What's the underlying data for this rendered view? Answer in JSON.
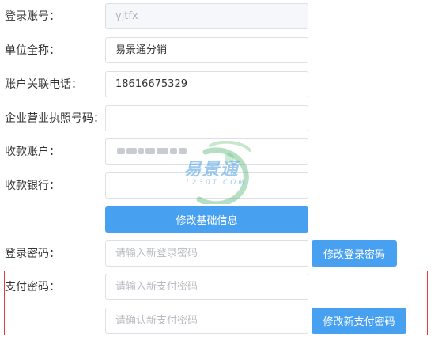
{
  "form": {
    "login_account": {
      "label": "登录账号：",
      "value": "yjtfx"
    },
    "company_name": {
      "label": "单位全称：",
      "value": "易景通分销"
    },
    "phone": {
      "label": "账户关联电话：",
      "value": "18616675329"
    },
    "license": {
      "label": "企业营业执照号码：",
      "value": ""
    },
    "receive_account": {
      "label": "收款账户："
    },
    "receive_bank": {
      "label": "收款银行：",
      "value": ""
    },
    "update_basic_button": "修改基础信息"
  },
  "login_password": {
    "label": "登录密码：",
    "placeholder": "请输入新登录密码",
    "button": "修改登录密码"
  },
  "pay_password": {
    "label": "支付密码：",
    "new_placeholder": "请输入新支付密码",
    "confirm_placeholder": "请确认新支付密码",
    "button": "修改新支付密码"
  },
  "watermark": {
    "brand": "易景通",
    "sub": "1230T.COM"
  },
  "colors": {
    "primary_button": "#48a0f0",
    "highlight_border": "#e4393c",
    "input_border": "#dcdfe6"
  }
}
